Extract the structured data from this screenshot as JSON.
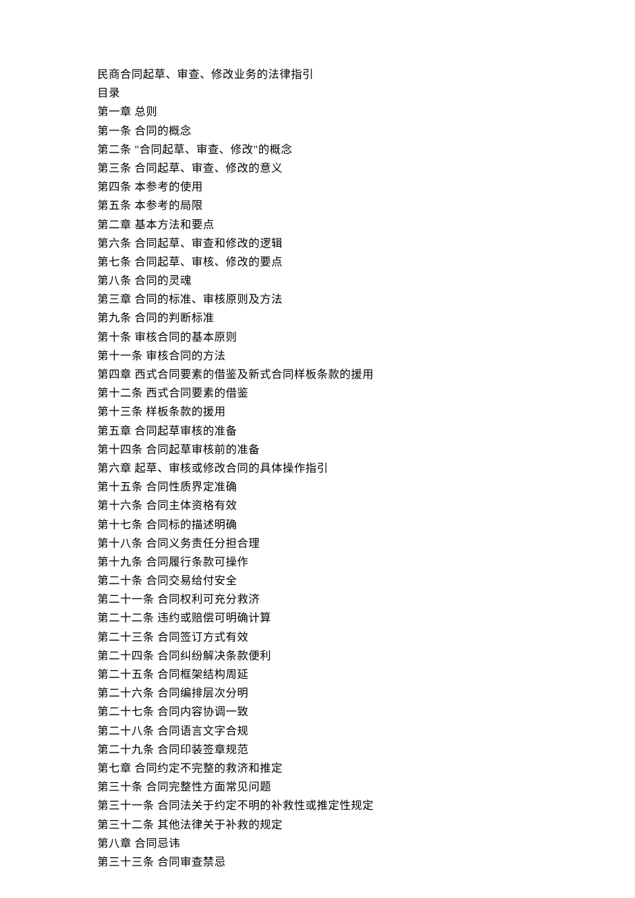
{
  "title": "民商合同起草、审查、修改业务的法律指引",
  "subtitle": "目录",
  "lines": [
    "第一章  总则",
    "第一条  合同的概念",
    "第二条  \"合同起草、审查、修改\"的概念",
    "第三条  合同起草、审查、修改的意义",
    "第四条  本参考的使用",
    "第五条  本参考的局限",
    "第二章  基本方法和要点",
    "第六条  合同起草、审查和修改的逻辑",
    "第七条  合同起草、审核、修改的要点",
    "第八条  合同的灵魂",
    "第三章  合同的标准、审核原则及方法",
    "第九条  合同的判断标准",
    "第十条  审核合同的基本原则",
    "第十一条  审核合同的方法",
    "第四章  西式合同要素的借鉴及新式合同样板条款的援用",
    "第十二条  西式合同要素的借鉴",
    "第十三条  样板条款的援用",
    "第五章  合同起草审核的准备",
    "第十四条  合同起草审核前的准备",
    "第六章  起草、审核或修改合同的具体操作指引",
    "第十五条  合同性质界定准确",
    "第十六条  合同主体资格有效",
    "第十七条  合同标的描述明确",
    "第十八条  合同义务责任分担合理",
    "第十九条  合同履行条款可操作",
    "第二十条  合同交易给付安全",
    "第二十一条  合同权利可充分救济",
    "第二十二条  违约或赔偿可明确计算",
    "第二十三条  合同签订方式有效",
    "第二十四条  合同纠纷解决条款便利",
    "第二十五条  合同框架结构周延",
    "第二十六条  合同编排层次分明",
    "第二十七条  合同内容协调一致",
    "第二十八条  合同语言文字合规",
    "第二十九条  合同印装签章规范",
    "第七章  合同约定不完整的救济和推定",
    "第三十条  合同完整性方面常见问题",
    "第三十一条  合同法关于约定不明的补救性或推定性规定",
    "第三十二条  其他法律关于补救的规定",
    "第八章  合同忌讳",
    "第三十三条  合同审查禁忌"
  ]
}
